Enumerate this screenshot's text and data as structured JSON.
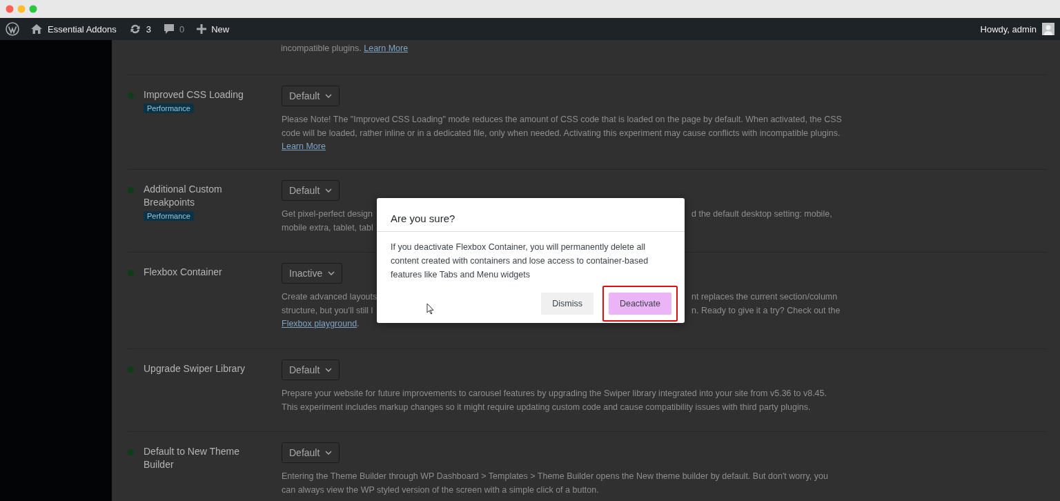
{
  "admin_bar": {
    "items": [
      {
        "kind": "wp-logo"
      },
      {
        "kind": "site",
        "label": "Essential Addons"
      },
      {
        "kind": "updates",
        "label": "3"
      },
      {
        "kind": "comments",
        "label": "0"
      },
      {
        "kind": "new",
        "label": "New"
      }
    ],
    "account": "Howdy, admin"
  },
  "top_fragment": {
    "text": "incompatible plugins.",
    "link": "Learn More"
  },
  "experiments": [
    {
      "name": "Improved CSS Loading",
      "tag": "Performance",
      "select": "Default",
      "description": [
        {
          "left": "Please Note! The \"Improved CSS Loading\" mode reduces the amount of CSS code that is loaded on the page by default. When activated, the CSS"
        },
        {
          "left": "code will be loaded, rather inline or in a dedicated file, only when needed. Activating this experiment may cause conflicts with incompatible plugins."
        },
        {
          "link": "Learn More"
        }
      ]
    },
    {
      "name": "Additional Custom Breakpoints",
      "tag": "Performance",
      "select": "Default",
      "description": [
        {
          "left": "Get pixel-perfect design",
          "right": "d the default desktop setting: mobile,"
        },
        {
          "left": "mobile extra, tablet, tabl"
        }
      ]
    },
    {
      "name": "Flexbox Container",
      "select": "Inactive",
      "description": [
        {
          "left": "Create advanced layouts",
          "right": "nt replaces the current section/column"
        },
        {
          "left": "structure, but you'll still l",
          "right": "n. Ready to give it a try? Check out the"
        },
        {
          "link": "Flexbox playground",
          "after": "."
        }
      ]
    },
    {
      "name": "Upgrade Swiper Library",
      "select": "Default",
      "description": [
        {
          "left": "Prepare your website for future improvements to carousel features by upgrading the Swiper library integrated into your site from v5.36 to v8.45."
        },
        {
          "left": "This experiment includes markup changes so it might require updating custom code and cause compatibility issues with third party plugins."
        }
      ]
    },
    {
      "name": "Default to New Theme Builder",
      "select": "Default",
      "description": [
        {
          "left": "Entering the Theme Builder through WP Dashboard > Templates > Theme Builder opens the New theme builder by default. But don't worry, you"
        },
        {
          "left": "can always view the WP styled version of the screen with a simple click of a button."
        }
      ]
    }
  ],
  "dialog": {
    "title": "Are you sure?",
    "message": "If you deactivate Flexbox Container, you will permanently delete all content created with containers and lose access to container-based features like Tabs and Menu widgets",
    "buttons": [
      {
        "label": "Dismiss",
        "kind": "secondary",
        "highlighted": false
      },
      {
        "label": "Deactivate",
        "kind": "primary",
        "highlighted": true
      }
    ]
  }
}
